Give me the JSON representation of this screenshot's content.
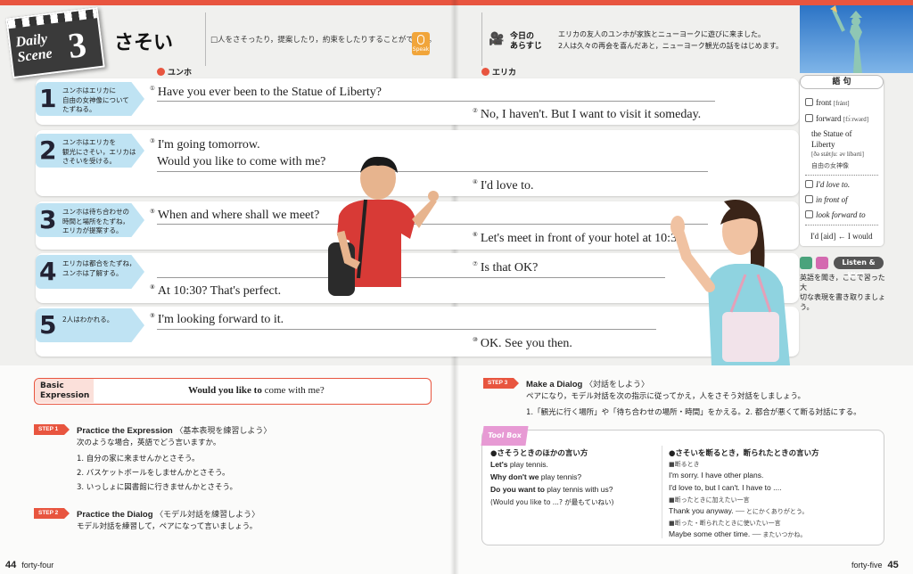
{
  "scene": {
    "label": "Daily Scene",
    "label_line1": "Daily",
    "label_line2": "Scene",
    "number": "3"
  },
  "title": "さそい",
  "title_desc": "□人をさそったり，提案したり，約束をしたりすることができる。",
  "speak_label": "Speak",
  "synopsis": {
    "label_line1": "今日の",
    "label_line2": "あらすじ",
    "line1": "エリカの友人のユンホが家族とニューヨークに遊びに来ました。",
    "line2": "2人は久々の再会を喜んだあと，ニューヨーク観光の話をはじめます。"
  },
  "speakers": {
    "left": "ユンホ",
    "right": "エリカ"
  },
  "rows": [
    {
      "num": "1",
      "desc": [
        "ユンホはエリカに",
        "自由の女神像について",
        "たずねる。"
      ],
      "lines": [
        {
          "c": "①",
          "text": "Have you ever been to the Statue of Liberty?"
        },
        {
          "c": "②",
          "text": "No, I haven't.  But I want to visit it someday."
        }
      ]
    },
    {
      "num": "2",
      "desc": [
        "ユンホはエリカを",
        "観光にさそい，エリカは",
        "さそいを受ける。"
      ],
      "lines": [
        {
          "c": "③",
          "text": "I'm going tomorrow."
        },
        {
          "c": "",
          "text": "Would you like to come with me?"
        },
        {
          "c": "④",
          "text": "I'd love to."
        }
      ]
    },
    {
      "num": "3",
      "desc": [
        "ユンホは待ち合わせの",
        "時間と場所をたずね，",
        "エリカが提案する。"
      ],
      "lines": [
        {
          "c": "⑤",
          "text": "When and where shall we meet?"
        },
        {
          "c": "⑥",
          "text": "Let's meet in front of your hotel at 10:30."
        }
      ]
    },
    {
      "num": "4",
      "desc": [
        "エリカは都合をたずね，",
        "ユンホは了解する。"
      ],
      "lines": [
        {
          "c": "⑦",
          "text": "Is that OK?"
        },
        {
          "c": "⑧",
          "text": "At 10:30?  That's perfect."
        }
      ]
    },
    {
      "num": "5",
      "desc": [
        "2人はわかれる。"
      ],
      "lines": [
        {
          "c": "⑨",
          "text": "I'm looking forward to it."
        },
        {
          "c": "⑩",
          "text": "OK.  See you then."
        }
      ]
    }
  ],
  "vocab": {
    "head": "語 句",
    "items": [
      {
        "word": "front",
        "ph": "[fránt]"
      },
      {
        "word": "forward",
        "ph": "[fɔ́ːrwərd]"
      },
      {
        "word": "the Statue of",
        "ph": ""
      },
      {
        "word": "Liberty",
        "ph": ""
      },
      {
        "word": "[ðə stǽtʃuː əv líbərti]",
        "ph": ""
      },
      {
        "word": "自由の女神像",
        "ph": ""
      }
    ],
    "phrases": [
      "I'd love to.",
      "in front of",
      "look forward to"
    ],
    "note": "I'd [aid] ← I would"
  },
  "listen_write": {
    "b1": "Listen",
    "b2": "Write",
    "label": "Listen & Write",
    "note": [
      "英語を聞き，ここで習った大",
      "切な表現を書き取りましょう。"
    ]
  },
  "basic": {
    "label1": "Basic",
    "label2": "Expression",
    "bold": "Would you like to",
    "rest": " come with me?"
  },
  "step1": {
    "tag": "STEP 1",
    "title": "Practice the Expression",
    "jp": "〈基本表現を練習しよう〉",
    "intro": "次のような場合，英語でどう言いますか。",
    "items": [
      "1. 自分の家に来ませんかとさそう。",
      "2. バスケットボールをしませんかとさそう。",
      "3. いっしょに図書館に行きませんかとさそう。"
    ]
  },
  "step2": {
    "tag": "STEP 2",
    "title": "Practice the Dialog",
    "jp": "〈モデル対話を練習しよう〉",
    "intro": "モデル対話を練習して，ペアになって言いましょう。"
  },
  "step3": {
    "tag": "STEP 3",
    "title": "Make a Dialog",
    "jp": "〈対話をしよう〉",
    "intro": "ペアになり，モデル対話を次の指示に従ってかえ，人をさそう対話をしましょう。",
    "item1": "1.「観光に行く場所」や「待ち合わせの場所・時間」をかえる。",
    "item2": "2. 都合が悪くて断る対話にする。"
  },
  "toolbox": {
    "badge": "Tool Box",
    "left_head": "●さそうときのほかの言い方",
    "left": [
      {
        "b": "Let's",
        "r": " play tennis."
      },
      {
        "b": "Why don't we",
        "r": " play tennis?"
      },
      {
        "b": "Do you want to",
        "r": " play tennis with us?"
      }
    ],
    "left_note": "(Would you like to ...? が最もていねい)",
    "right_head": "●さそいを断るとき，断られたときの言い方",
    "right_sub1": "■断るとき",
    "right1": "I'm sorry.  I have other plans.",
    "right2": "I'd love to, but I can't.  I have to ....",
    "right_sub2": "■断ったときに加えたい一言",
    "right3": "Thank you anyway.",
    "right3_note": "── とにかくありがとう。",
    "right_sub3": "■断った・断られたときに使いたい一言",
    "right4": "Maybe some other time.",
    "right4_note": "── またいつかね。"
  },
  "pages": {
    "left_num": "44",
    "left_word": "forty-four",
    "right_num": "45",
    "right_word": "forty-five"
  }
}
